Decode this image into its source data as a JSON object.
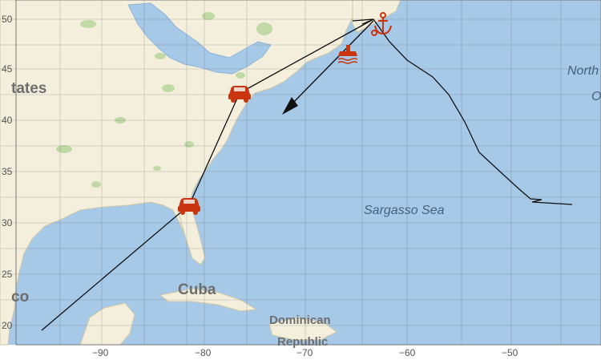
{
  "map": {
    "latitude_ticks": [
      "20",
      "25",
      "30",
      "35",
      "40",
      "45",
      "50"
    ],
    "longitude_ticks": [
      "−90",
      "−80",
      "−70",
      "−60",
      "−50"
    ],
    "labels": {
      "states": "tates",
      "north": "North",
      "north2": "O",
      "sargasso": "Sargasso Sea",
      "mexico": "co",
      "cuba": "Cuba",
      "dominican": "Dominican",
      "republic": "Republic"
    },
    "colors": {
      "ocean": "#a7c9e8",
      "land": "#f3efdc",
      "route": "#111111",
      "icon": "#c8350f",
      "grid": "#6d6d6d"
    },
    "icons": {
      "car_1": "car-icon",
      "car_2": "car-icon",
      "ship": "ship-icon",
      "anchor": "anchor-icon",
      "arrow": "arrowhead-icon"
    }
  }
}
